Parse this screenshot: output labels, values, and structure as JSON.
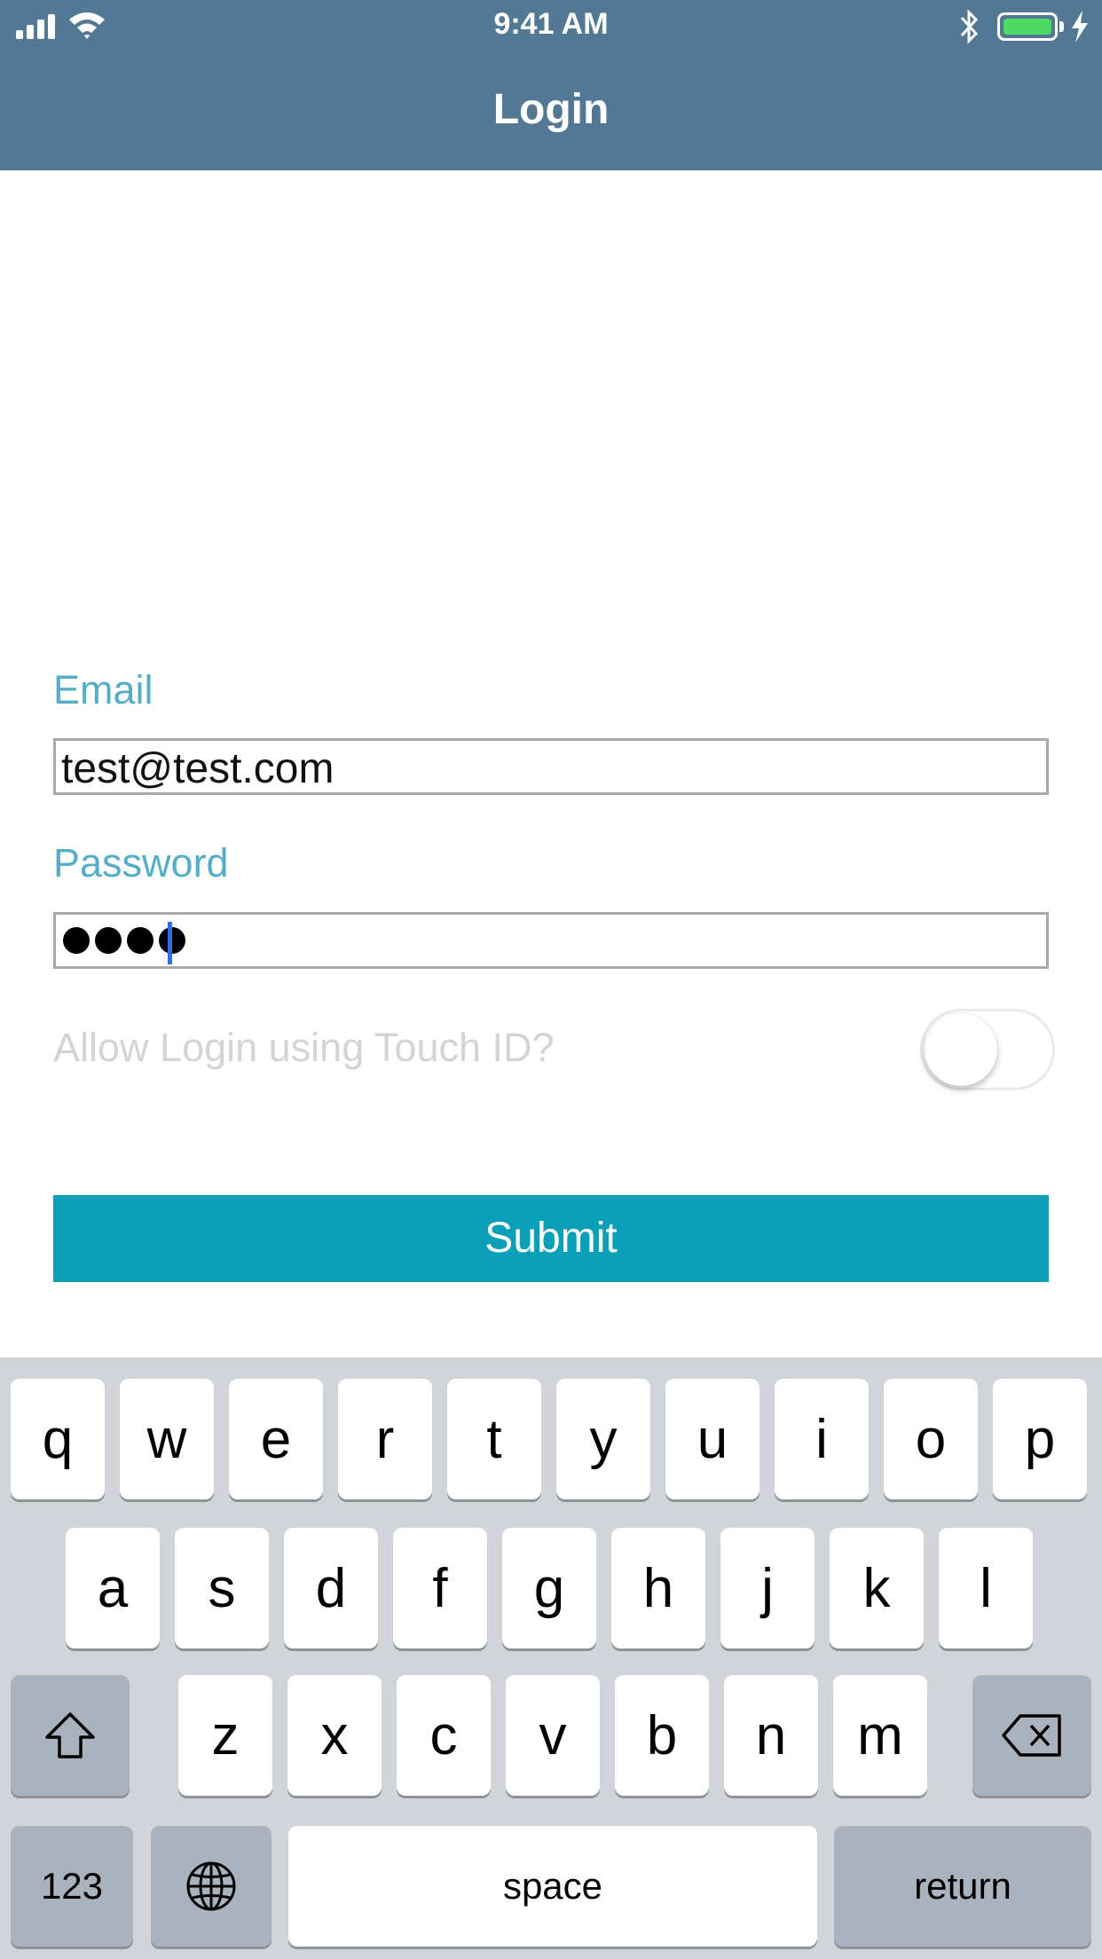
{
  "status_bar": {
    "time": "9:41 AM"
  },
  "nav": {
    "title": "Login"
  },
  "form": {
    "email_label": "Email",
    "email_value": "test@test.com",
    "password_label": "Password",
    "password_length": 4,
    "touch_id_label": "Allow Login using Touch ID?",
    "touch_id_enabled": false,
    "submit_label": "Submit"
  },
  "keyboard": {
    "row1": [
      "q",
      "w",
      "e",
      "r",
      "t",
      "y",
      "u",
      "i",
      "o",
      "p"
    ],
    "row2": [
      "a",
      "s",
      "d",
      "f",
      "g",
      "h",
      "j",
      "k",
      "l"
    ],
    "row3": [
      "z",
      "x",
      "c",
      "v",
      "b",
      "n",
      "m"
    ],
    "numbers_label": "123",
    "space_label": "space",
    "return_label": "return"
  },
  "colors": {
    "nav_bar": "#537893",
    "label": "#55aec6",
    "submit": "#0ba0b7",
    "battery": "#4cd964"
  }
}
